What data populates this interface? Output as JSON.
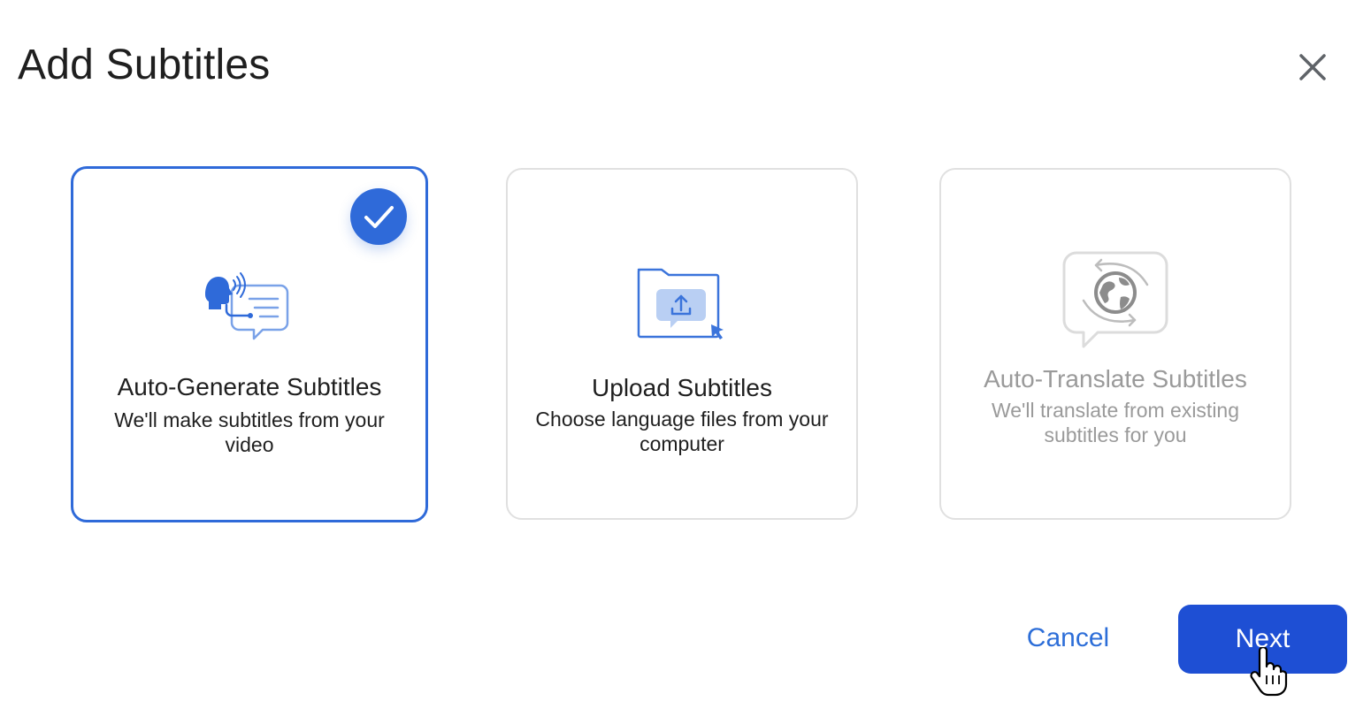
{
  "dialog": {
    "title": "Add Subtitles"
  },
  "options": [
    {
      "title": "Auto-Generate Subtitles",
      "description": "We'll make subtitles from your video",
      "icon": "speech-to-text-icon",
      "selected": true,
      "disabled": false
    },
    {
      "title": "Upload Subtitles",
      "description": "Choose language files from your computer",
      "icon": "folder-upload-icon",
      "selected": false,
      "disabled": false
    },
    {
      "title": "Auto-Translate Subtitles",
      "description": "We'll translate from existing subtitles for you",
      "icon": "globe-translate-icon",
      "selected": false,
      "disabled": true
    }
  ],
  "footer": {
    "cancel_label": "Cancel",
    "next_label": "Next"
  },
  "colors": {
    "accent": "#2f6ad9",
    "primary_button": "#1e4fd4",
    "link": "#2d6ed8",
    "disabled_text": "#9a9a9a"
  }
}
